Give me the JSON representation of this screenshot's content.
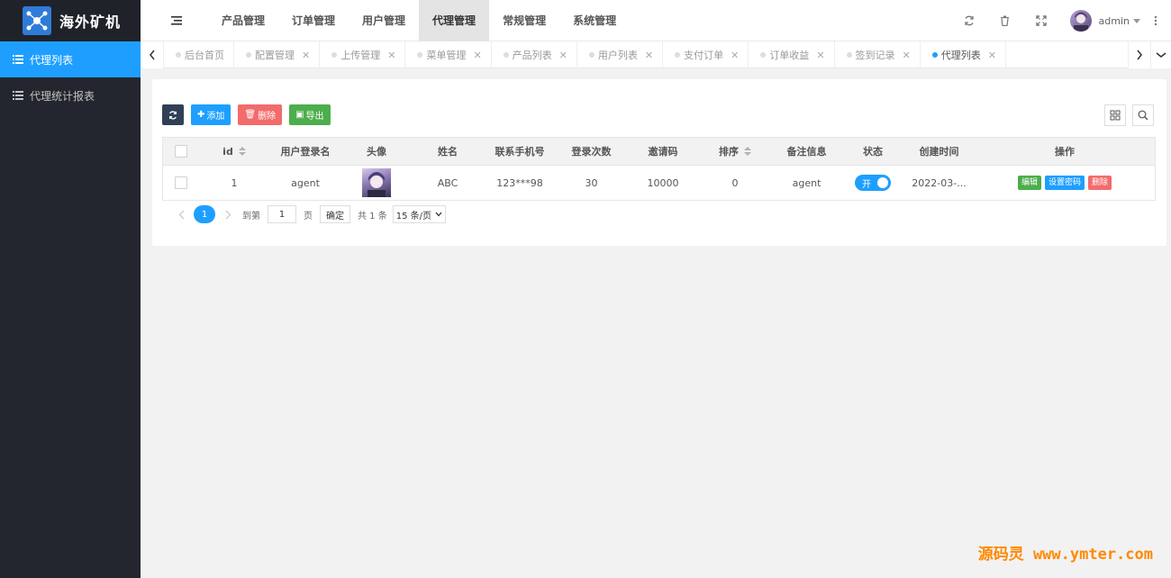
{
  "app": {
    "title": "海外矿机"
  },
  "sidebar": {
    "items": [
      {
        "label": "代理列表"
      },
      {
        "label": "代理统计报表"
      }
    ]
  },
  "header": {
    "nav": [
      "产品管理",
      "订单管理",
      "用户管理",
      "代理管理",
      "常规管理",
      "系统管理"
    ],
    "active_nav": "代理管理",
    "user": "admin"
  },
  "tabs": [
    "后台首页",
    "配置管理",
    "上传管理",
    "菜单管理",
    "产品列表",
    "用户列表",
    "支付订单",
    "订单收益",
    "签到记录",
    "代理列表"
  ],
  "toolbar": {
    "add": "添加",
    "delete": "删除",
    "export": "导出"
  },
  "table": {
    "columns": [
      "id",
      "用户登录名",
      "头像",
      "姓名",
      "联系手机号",
      "登录次数",
      "邀请码",
      "排序",
      "备注信息",
      "状态",
      "创建时间",
      "操作"
    ],
    "rows": [
      {
        "id": "1",
        "username": "agent",
        "name": "ABC",
        "phone": "123***98",
        "logins": "30",
        "invite": "10000",
        "sort": "0",
        "remark": "agent",
        "status": "开",
        "created": "2022-03-...",
        "actions": [
          "编辑",
          "设置密码",
          "删除"
        ]
      }
    ]
  },
  "pager": {
    "current": "1",
    "goto_prefix": "到第",
    "goto_value": "1",
    "page_suffix": "页",
    "confirm": "确定",
    "total": "共 1 条",
    "per_page": "15 条/页"
  },
  "watermark": "源码灵 www.ymter.com",
  "colors": {
    "accent": "#1e9fff",
    "sidebar": "#23262e",
    "danger": "#f26c6c",
    "success": "#4cae4c"
  }
}
